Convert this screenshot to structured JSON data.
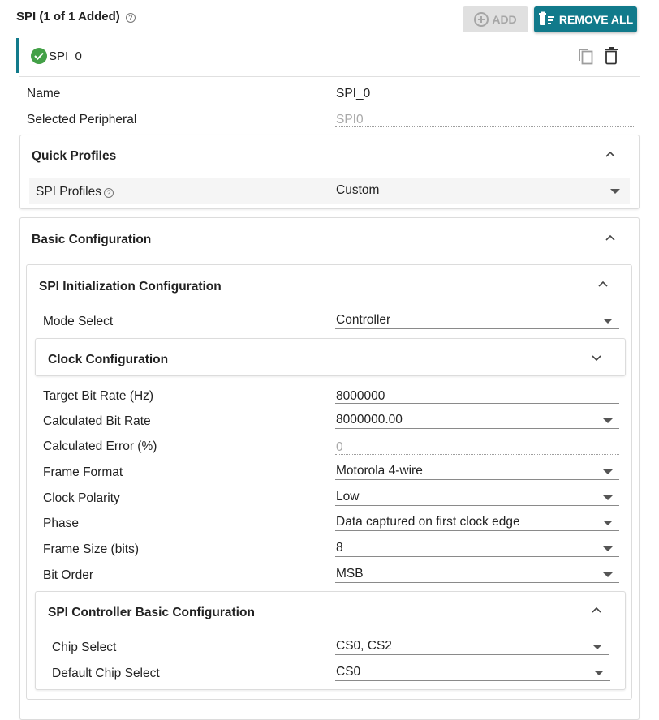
{
  "header": {
    "title": "SPI (1 of 1 Added)",
    "add_label": "ADD",
    "remove_all_label": "REMOVE ALL"
  },
  "instance": {
    "name": "SPI_0"
  },
  "fields": {
    "name": {
      "label": "Name",
      "value": "SPI_0"
    },
    "peripheral": {
      "label": "Selected Peripheral",
      "value": "SPI0"
    }
  },
  "quick_profiles": {
    "title": "Quick Profiles",
    "profile_label": "SPI Profiles",
    "profile_value": "Custom"
  },
  "basic": {
    "title": "Basic Configuration",
    "init": {
      "title": "SPI Initialization Configuration",
      "mode_label": "Mode Select",
      "mode_value": "Controller"
    },
    "clock": {
      "title": "Clock Configuration"
    },
    "rows": [
      {
        "label": "Target Bit Rate (Hz)",
        "value": "8000000"
      },
      {
        "label": "Calculated Bit Rate",
        "value": "8000000.00"
      },
      {
        "label": "Calculated Error (%)",
        "value": "0"
      },
      {
        "label": "Frame Format",
        "value": "Motorola 4-wire"
      },
      {
        "label": "Clock Polarity",
        "value": "Low"
      },
      {
        "label": "Phase",
        "value": "Data captured on first clock edge"
      },
      {
        "label": "Frame Size (bits)",
        "value": "8"
      },
      {
        "label": "Bit Order",
        "value": "MSB"
      }
    ],
    "controller": {
      "title": "SPI Controller Basic Configuration",
      "chip_select_label": "Chip Select",
      "chip_select_value": "CS0, CS2",
      "default_cs_label": "Default Chip Select",
      "default_cs_value": "CS0"
    }
  },
  "colors": {
    "accent": "#117a8b",
    "success": "#43a047",
    "disabled_btn": "#e0e0e0"
  },
  "icons": [
    "help-icon",
    "add-circle-icon",
    "remove-all-icon",
    "check-circle-icon",
    "copy-icon",
    "trash-icon",
    "chevron-up-icon",
    "chevron-down-icon",
    "dropdown-caret-icon"
  ]
}
